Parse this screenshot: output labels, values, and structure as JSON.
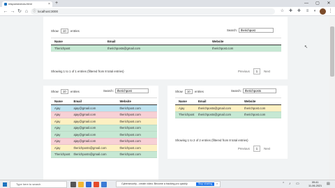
{
  "browser": {
    "tab_title": "responsivecsv.html",
    "tab_close": "×",
    "new_tab": "+",
    "url": "localhost:3000",
    "window_controls": [
      "—",
      "▢",
      "✕"
    ]
  },
  "top_table": {
    "show_prefix": "Show",
    "length_value": "10",
    "show_suffix": "entries",
    "search_label": "Search:",
    "search_value": "therichpost",
    "headers": [
      "Name",
      "Email",
      "Website"
    ],
    "rows": [
      {
        "name": "Therichpost",
        "email": "therichposts@gmail.com",
        "website": "therichpost.com",
        "color": "#c6e8d3"
      }
    ],
    "info": "Showing 1 to 1 of 1 entries (filtered from 8 total entries)",
    "previous": "Previous",
    "page": "1",
    "next": "Next"
  },
  "left_table": {
    "show_prefix": "Show",
    "length_value": "10",
    "show_suffix": "entries",
    "search_label": "Search:",
    "search_value": "therichpost",
    "headers": [
      "Name",
      "Email",
      "Website"
    ],
    "rows": [
      {
        "name": "Ajay",
        "email": "ajay@gmail.com",
        "website": "therichpost.com",
        "color": "#bfe3ef"
      },
      {
        "name": "Ajay",
        "email": "ajay@gmail.com",
        "website": "therichpost.com",
        "color": "#f7d0d5"
      },
      {
        "name": "Ajay",
        "email": "ajay@gmail.com",
        "website": "therichpost.com",
        "color": "#fdf0c2"
      },
      {
        "name": "Ajay",
        "email": "ajay@gmail.com",
        "website": "therichpost.com",
        "color": "#c6e8d3"
      },
      {
        "name": "Ajay",
        "email": "ajay@gmail.com",
        "website": "therichpost.com",
        "color": "#c6e8d3"
      },
      {
        "name": "Ajay",
        "email": "ajay@gmail.com",
        "website": "therichpost.com",
        "color": "#f7d0d5"
      },
      {
        "name": "Ajay",
        "email": "therichposts@gmail.com",
        "website": "therichpost.com",
        "color": "#fdf0c2"
      },
      {
        "name": "Therichpost",
        "email": "therichposts@gmail.com",
        "website": "therichpost.com",
        "color": "#c6e8d3"
      }
    ]
  },
  "right_table": {
    "show_prefix": "Show",
    "length_value": "10",
    "show_suffix": "entries",
    "search_label": "Search:",
    "search_value": "therichposts",
    "headers": [
      "Name",
      "Email",
      "Website"
    ],
    "rows": [
      {
        "name": "Ajay",
        "email": "therichposts@gmail.com",
        "website": "therichpost.com",
        "color": "#fdf0c2"
      },
      {
        "name": "Therichpost",
        "email": "therichposts@gmail.com",
        "website": "therichpost.com",
        "color": "#c6e8d3"
      }
    ],
    "info": "Showing 1 to 2 of 2 entries (filtered from 8 total entries)",
    "previous": "Previous",
    "page": "1",
    "next": "Next"
  },
  "taskbar": {
    "search_placeholder": "Type here to search",
    "notification": "Cybersecurity - create video: Become a tracking pro quickly",
    "notification_button": "Stop sharing",
    "notification_close": "×",
    "time": "09:41",
    "date": "11-06-2021"
  },
  "icons": [
    "back-icon",
    "forward-icon",
    "reload-icon",
    "home-icon",
    "windows-icon",
    "mouse-cursor-icon"
  ]
}
